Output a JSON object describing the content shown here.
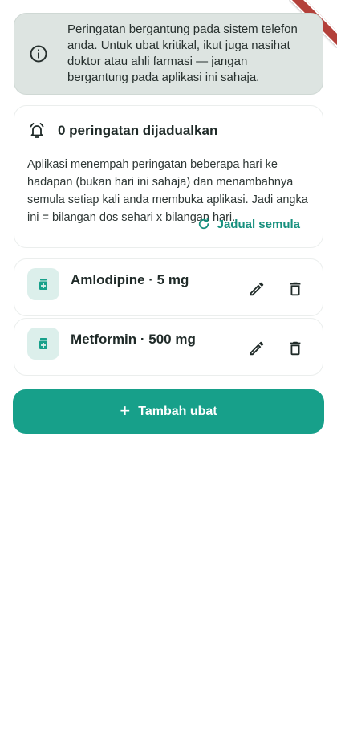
{
  "notice": {
    "text": "Peringatan bergantung pada sistem telefon anda. Untuk ubat kritikal, ikut juga nasihat doktor atau ahli farmasi — jangan bergantung pada aplikasi ini sahaja.",
    "icon": "info-icon"
  },
  "schedule": {
    "title": "0 peringatan dijadualkan",
    "description": "Aplikasi menempah peringatan beberapa hari ke hadapan (bukan hari ini sahaja) dan menambahnya semula setiap kali anda membuka aplikasi. Jadi angka ini = bilangan dos sehari x bilangan hari.",
    "reschedule_label": "Jadual semula"
  },
  "medications": [
    {
      "name": "Amlodipine · 5 mg"
    },
    {
      "name": "Metformin · 500 mg"
    }
  ],
  "add_button": {
    "label": "Tambah ubat"
  },
  "colors": {
    "accent": "#17a08a",
    "accent_text": "#17907e",
    "notice_bg": "#dde4e1",
    "pill_bg": "#dcefeb"
  }
}
